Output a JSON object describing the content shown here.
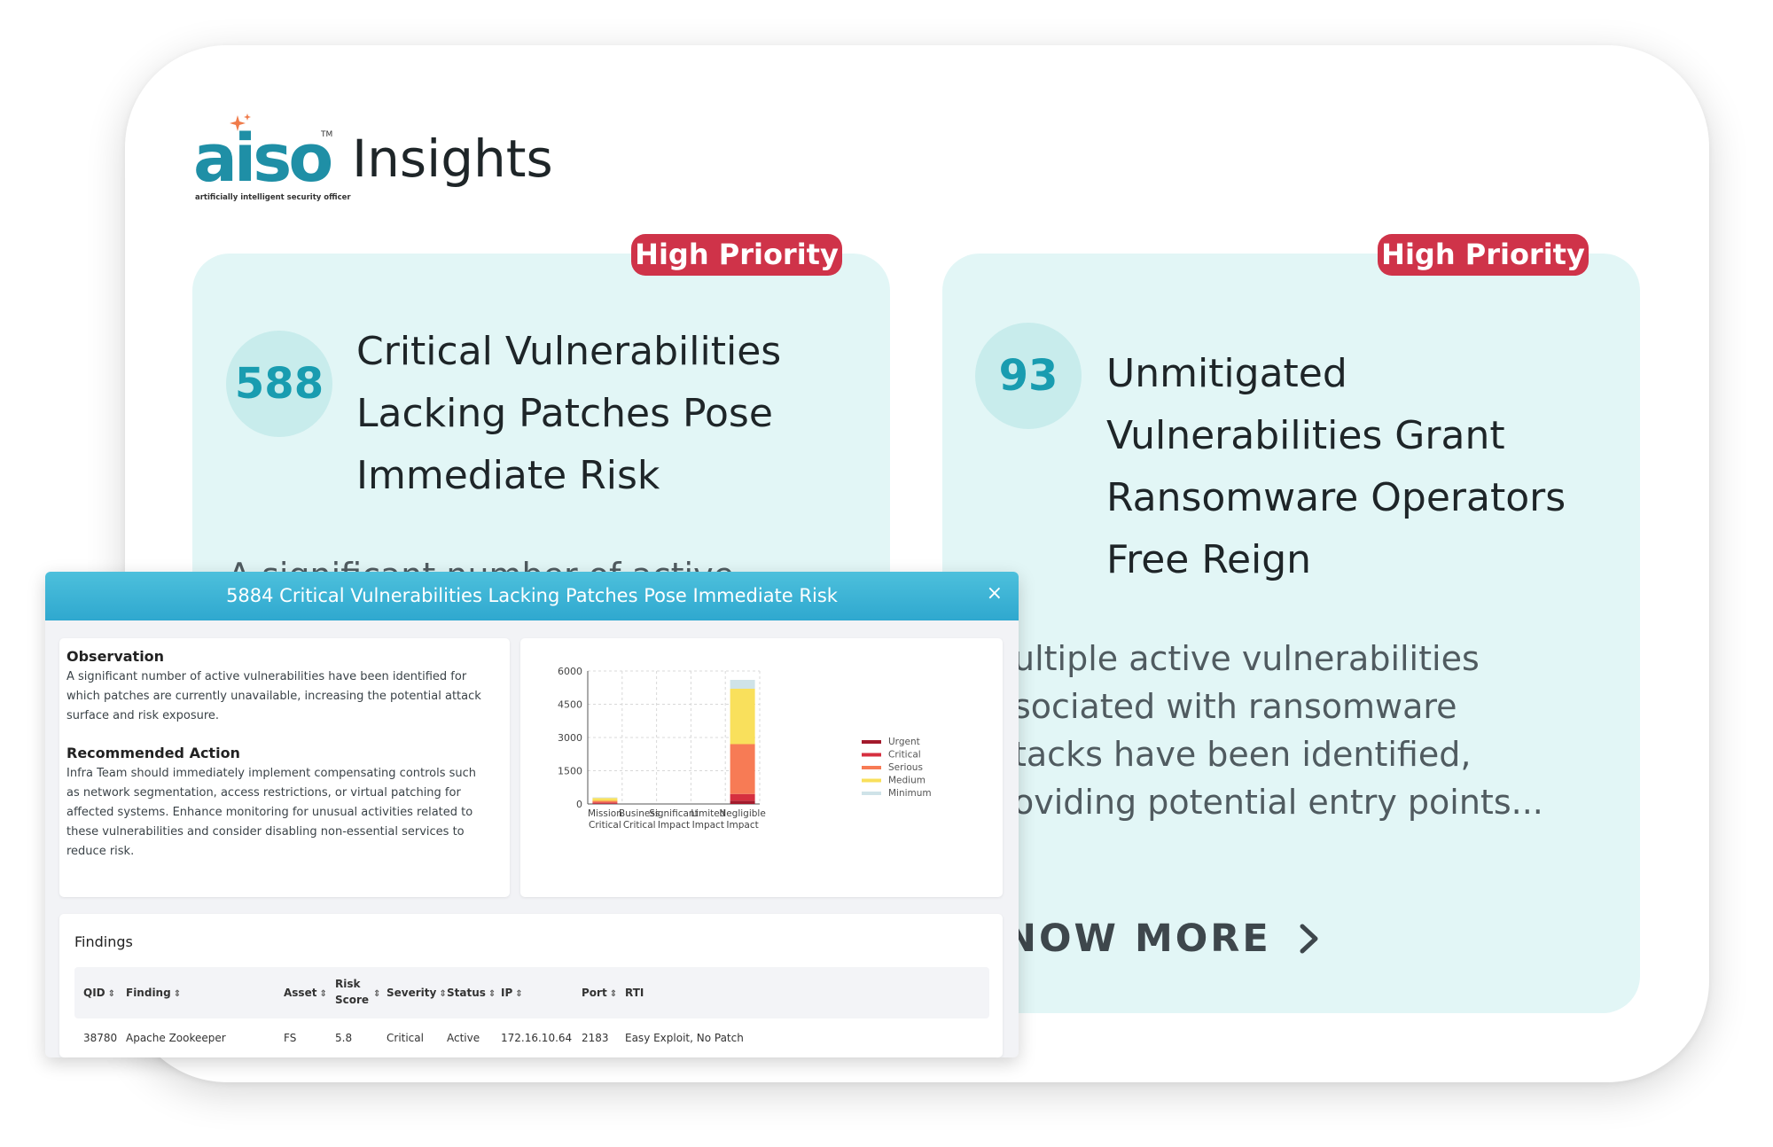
{
  "brand": {
    "logo_text": "aiso",
    "logo_tm": "TM",
    "logo_subtitle": "artificially intelligent security officer",
    "page_title": "Insights"
  },
  "cards": [
    {
      "badge": "High Priority",
      "count": "588",
      "title_lines": [
        "Critical Vulnerabilities",
        "Lacking Patches Pose",
        "Immediate Risk"
      ],
      "desc_visible": "A significant number of active"
    },
    {
      "badge": "High Priority",
      "count": "93",
      "title_lines": [
        "Unmitigated",
        "Vulnerabilities Grant",
        "Ransomware Operators",
        "Free Reign"
      ],
      "desc_lines": [
        "ultiple active vulnerabilities",
        "sociated with ransomware",
        "tacks have been identified,",
        "oviding potential entry points..."
      ],
      "cta": "KNOW MORE",
      "cta_visible": "NOW MORE"
    }
  ],
  "modal": {
    "title": "5884 Critical Vulnerabilities Lacking Patches Pose Immediate Risk",
    "close": "×",
    "observation_heading": "Observation",
    "observation_lines": [
      "A significant number of active vulnerabilities have been identified for",
      "which patches are currently unavailable, increasing the potential attack",
      "surface and risk exposure."
    ],
    "action_heading": "Recommended Action",
    "action_lines": [
      "Infra Team should immediately implement compensating controls such",
      "as network segmentation, access restrictions, or virtual patching for",
      "affected systems. Enhance monitoring for unusual activities related to",
      "these vulnerabilities and consider disabling non-essential services to",
      "reduce risk."
    ],
    "findings_heading": "Findings",
    "table_headers": [
      "QID",
      "Finding",
      "Asset",
      "Risk Score",
      "Severity",
      "Status",
      "IP",
      "Port",
      "RTI"
    ],
    "table_rows": [
      [
        "38780",
        "Apache Zookeeper",
        "FS",
        "5.8",
        "Critical",
        "Active",
        "172.16.10.64",
        "2183",
        "Easy Exploit, No Patch"
      ]
    ]
  },
  "chart_data": {
    "type": "bar",
    "stacked": true,
    "categories": [
      "Mission Critical",
      "Business Critical",
      "Significant Impact",
      "Limited Impact",
      "Negligible Impact"
    ],
    "category_lines": [
      [
        "Mission",
        "Critical"
      ],
      [
        "Business",
        "Critical"
      ],
      [
        "Significant",
        "Impact"
      ],
      [
        "Limited",
        "Impact"
      ],
      [
        "Negligible",
        "Impact"
      ]
    ],
    "series": [
      {
        "name": "Urgent",
        "color": "#a31a2c",
        "values": [
          30,
          0,
          0,
          0,
          150
        ]
      },
      {
        "name": "Critical",
        "color": "#d62f3f",
        "values": [
          40,
          0,
          0,
          0,
          300
        ]
      },
      {
        "name": "Serious",
        "color": "#f77b55",
        "values": [
          70,
          0,
          0,
          0,
          2250
        ]
      },
      {
        "name": "Medium",
        "color": "#f9e05c",
        "values": [
          130,
          0,
          0,
          0,
          2500
        ]
      },
      {
        "name": "Minimum",
        "color": "#cfe3e8",
        "values": [
          30,
          0,
          0,
          0,
          400
        ]
      }
    ],
    "yticks": [
      "6000",
      "4500",
      "3000",
      "1500",
      "0"
    ],
    "ylim": [
      0,
      6000
    ],
    "grid": true,
    "legend": "right"
  },
  "colors": {
    "brand_teal": "#1f8fa6",
    "badge_red": "#cf3349",
    "card_bg": "#e2f6f6",
    "modal_header": "#3bb4d6"
  }
}
